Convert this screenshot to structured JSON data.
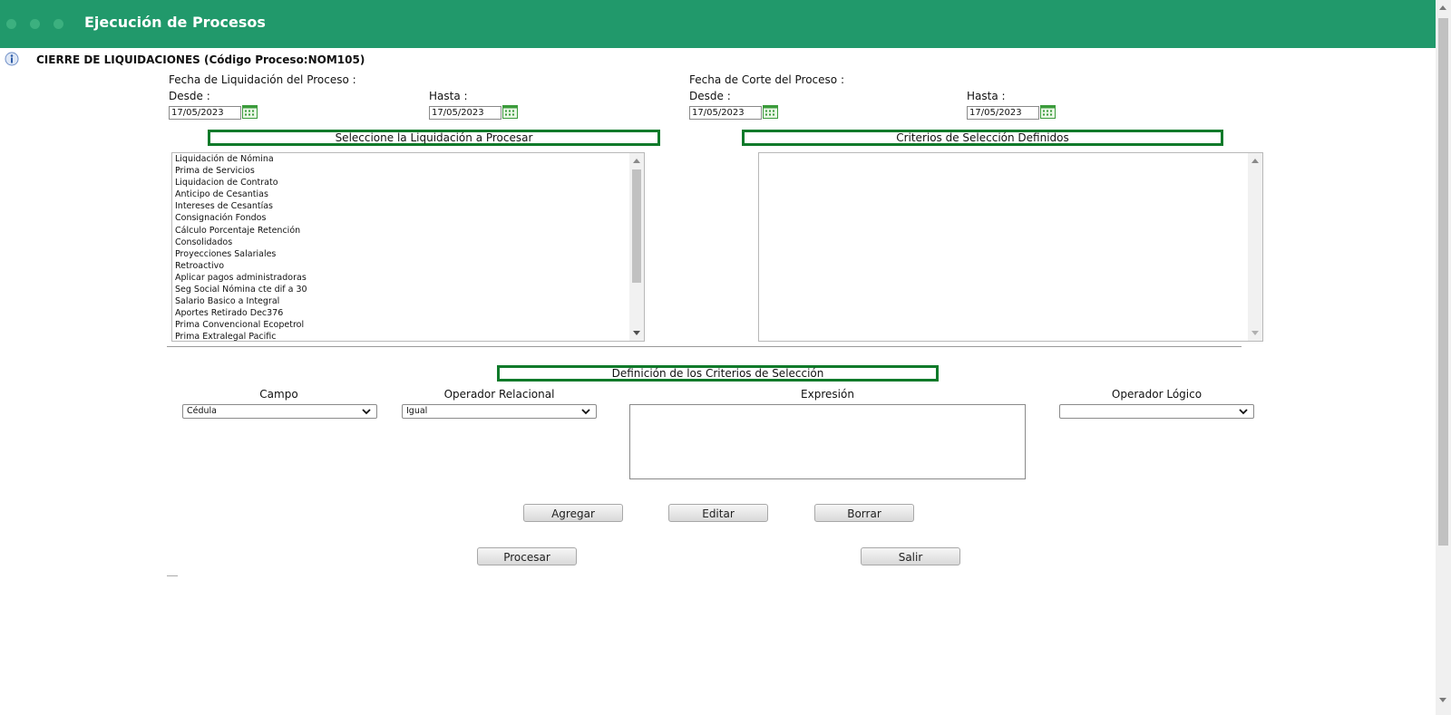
{
  "app": {
    "title": "Ejecución de Procesos",
    "brand_color": "#21996b"
  },
  "process": {
    "title": "CIERRE DE LIQUIDACIONES (Código Proceso:NOM105)"
  },
  "liquidation_date": {
    "label": "Fecha de Liquidación del Proceso :",
    "from_label": "Desde :",
    "from_value": "17/05/2023",
    "to_label": "Hasta :",
    "to_value": "17/05/2023"
  },
  "cut_date": {
    "label": "Fecha de Corte del Proceso :",
    "from_label": "Desde :",
    "from_value": "17/05/2023",
    "to_label": "Hasta :",
    "to_value": "17/05/2023"
  },
  "liquidations": {
    "header": "Seleccione la Liquidación a Procesar",
    "items": [
      "Liquidación de Nómina",
      "Prima de Servicios",
      "Liquidacion de Contrato",
      "Anticipo de Cesantias",
      "Intereses de Cesantías",
      "Consignación Fondos",
      "Cálculo Porcentaje Retención",
      "Consolidados",
      "Proyecciones Salariales",
      "Retroactivo",
      "Aplicar pagos administradoras",
      "Seg Social Nómina cte dif a 30",
      "Salario Basico a Integral",
      "Aportes Retirado Dec376",
      "Prima Convencional Ecopetrol",
      "Prima Extralegal Pacific"
    ]
  },
  "criteria_defined": {
    "header": "Criterios de Selección Definidos"
  },
  "criteria_definition": {
    "header": "Definición de los Criterios de Selección",
    "field_label": "Campo",
    "field_value": "Cédula",
    "relational_label": "Operador Relacional",
    "relational_value": "Igual",
    "expression_label": "Expresión",
    "logical_label": "Operador Lógico",
    "logical_value": ""
  },
  "buttons": {
    "add": "Agregar",
    "edit": "Editar",
    "delete": "Borrar",
    "process": "Procesar",
    "exit": "Salir"
  }
}
